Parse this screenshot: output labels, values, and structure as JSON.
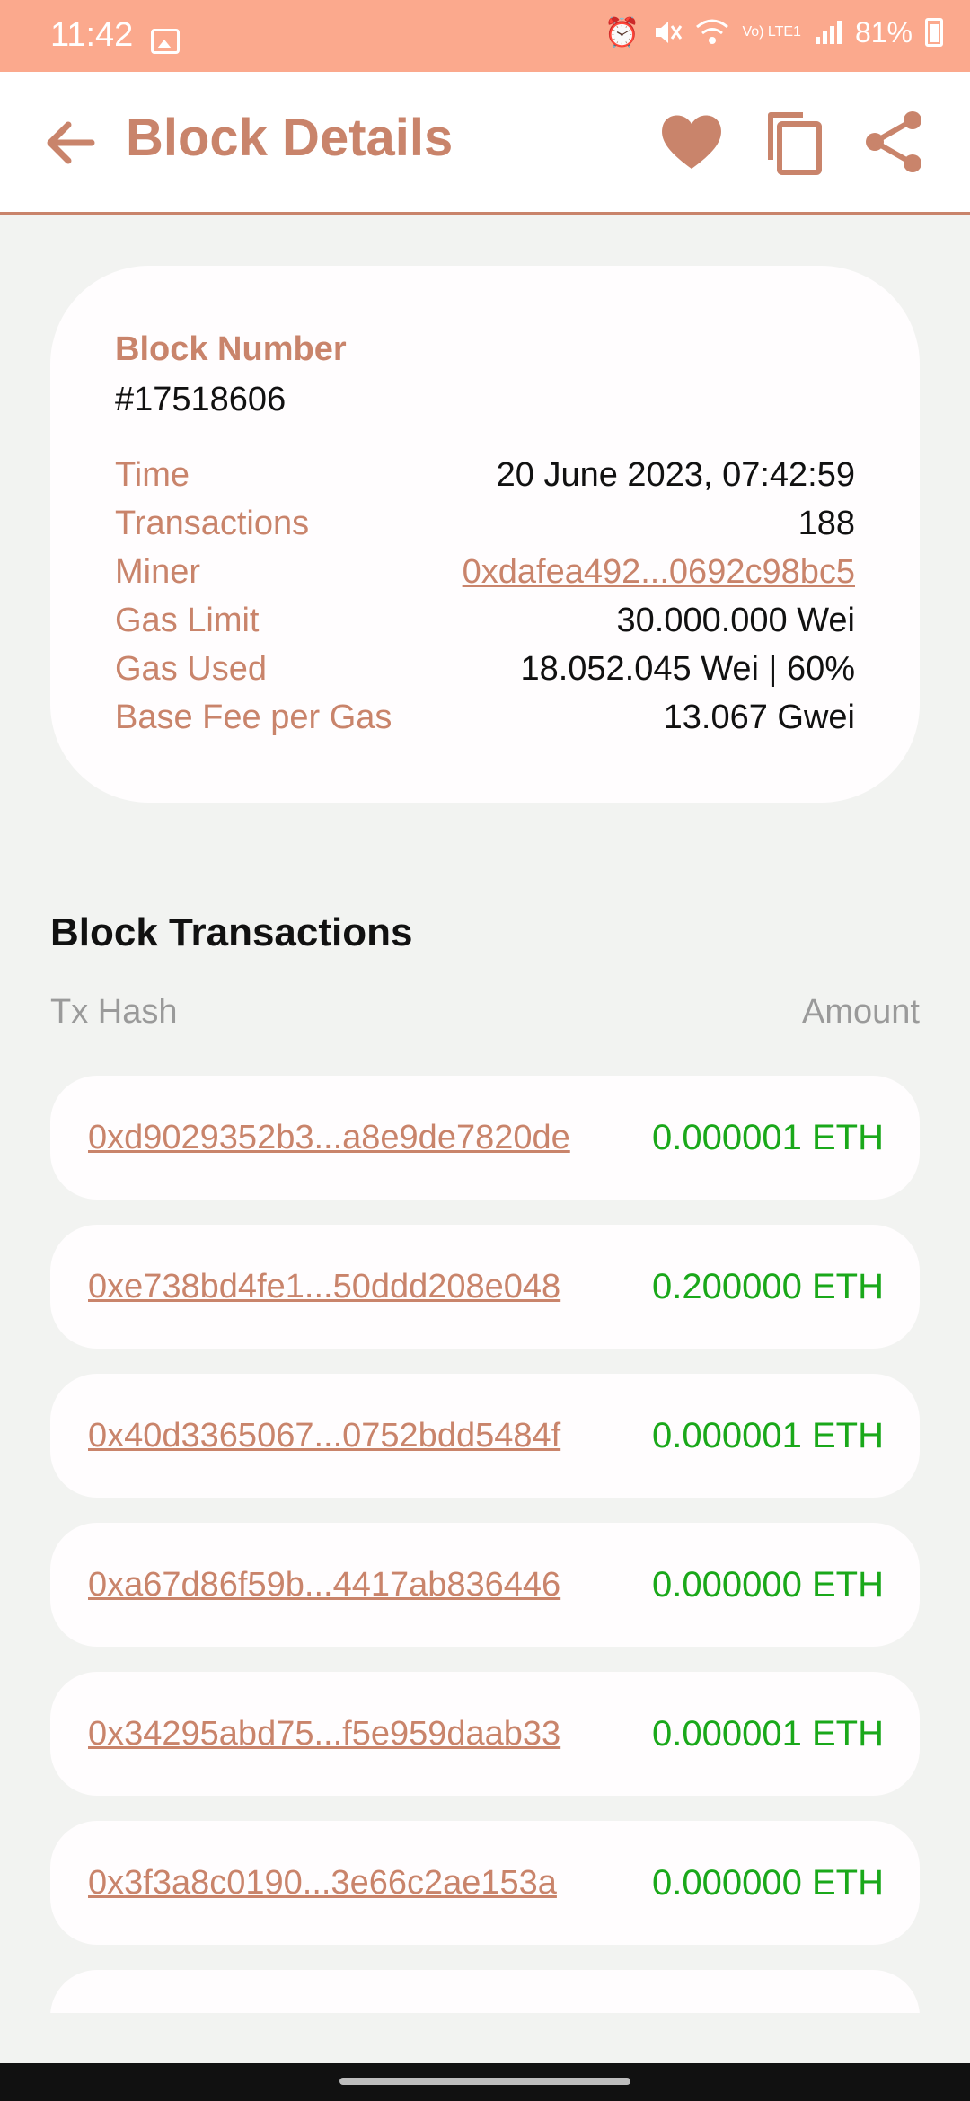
{
  "status_bar": {
    "time": "11:42",
    "battery": "81%",
    "network": "Vo) LTE1",
    "icons": [
      "gallery-icon",
      "alarm-icon",
      "mute-icon",
      "wifi-icon",
      "signal-icon",
      "battery-icon"
    ]
  },
  "app_bar": {
    "title": "Block Details",
    "icons": [
      "back-arrow-icon",
      "heart-icon",
      "copy-icon",
      "share-icon"
    ]
  },
  "block": {
    "number_label": "Block Number",
    "number_value": "#17518606",
    "rows": [
      {
        "label": "Time",
        "value": "20 June 2023, 07:42:59"
      },
      {
        "label": "Transactions",
        "value": "188"
      },
      {
        "label": "Miner",
        "value": "0xdafea492...0692c98bc5"
      },
      {
        "label": "Gas Limit",
        "value": "30.000.000 Wei"
      },
      {
        "label": "Gas Used",
        "value": "18.052.045 Wei | 60%"
      },
      {
        "label": "Base Fee per Gas",
        "value": "13.067 Gwei"
      }
    ]
  },
  "transactions": {
    "title": "Block Transactions",
    "col_hash": "Tx Hash",
    "col_amount": "Amount",
    "items": [
      {
        "hash": "0xd9029352b3...a8e9de7820de",
        "amount": "0.000001 ETH"
      },
      {
        "hash": "0xe738bd4fe1...50ddd208e048",
        "amount": "0.200000 ETH"
      },
      {
        "hash": "0x40d3365067...0752bdd5484f",
        "amount": "0.000001 ETH"
      },
      {
        "hash": "0xa67d86f59b...4417ab836446",
        "amount": "0.000000 ETH"
      },
      {
        "hash": "0x34295abd75...f5e959daab33",
        "amount": "0.000001 ETH"
      },
      {
        "hash": "0x3f3a8c0190...3e66c2ae153a",
        "amount": "0.000000 ETH"
      }
    ]
  },
  "colors": {
    "status_bar": "#fba98d",
    "accent": "#c9846b",
    "amount_green": "#1aa81a",
    "background": "#f2f3f1"
  }
}
